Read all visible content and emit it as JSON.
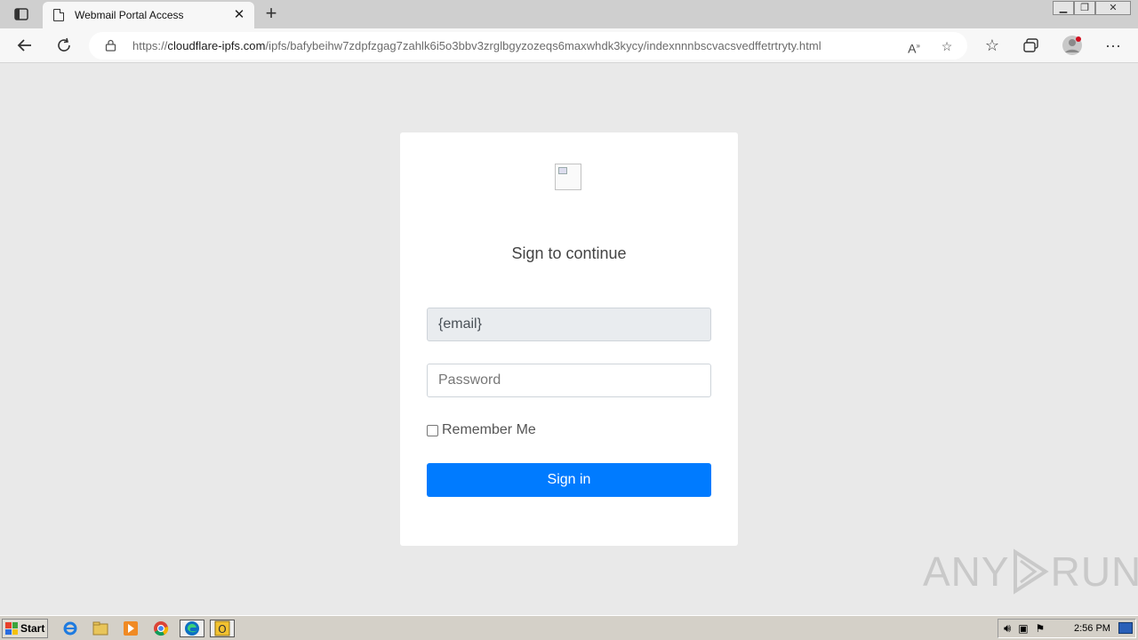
{
  "browser": {
    "tab_title": "Webmail Portal Access",
    "url_prefix": "https://",
    "url_domain": "cloudflare-ipfs.com",
    "url_path": "/ipfs/bafybeihw7zdpfzgag7zahlk6i5o3bbv3zrglbgyzozeqs6maxwhdk3kycy/indexnnnbscvacsvedffetrtryty.html"
  },
  "login": {
    "heading": "Sign to continue",
    "email_value": "{email}",
    "password_placeholder": "Password",
    "remember_label": "Remember Me",
    "signin_label": "Sign in"
  },
  "watermark": {
    "left": "ANY",
    "right": "RUN"
  },
  "taskbar": {
    "start_label": "Start",
    "clock": "2:56 PM"
  },
  "colors": {
    "accent": "#007bff",
    "page_bg": "#e9e9e9"
  }
}
